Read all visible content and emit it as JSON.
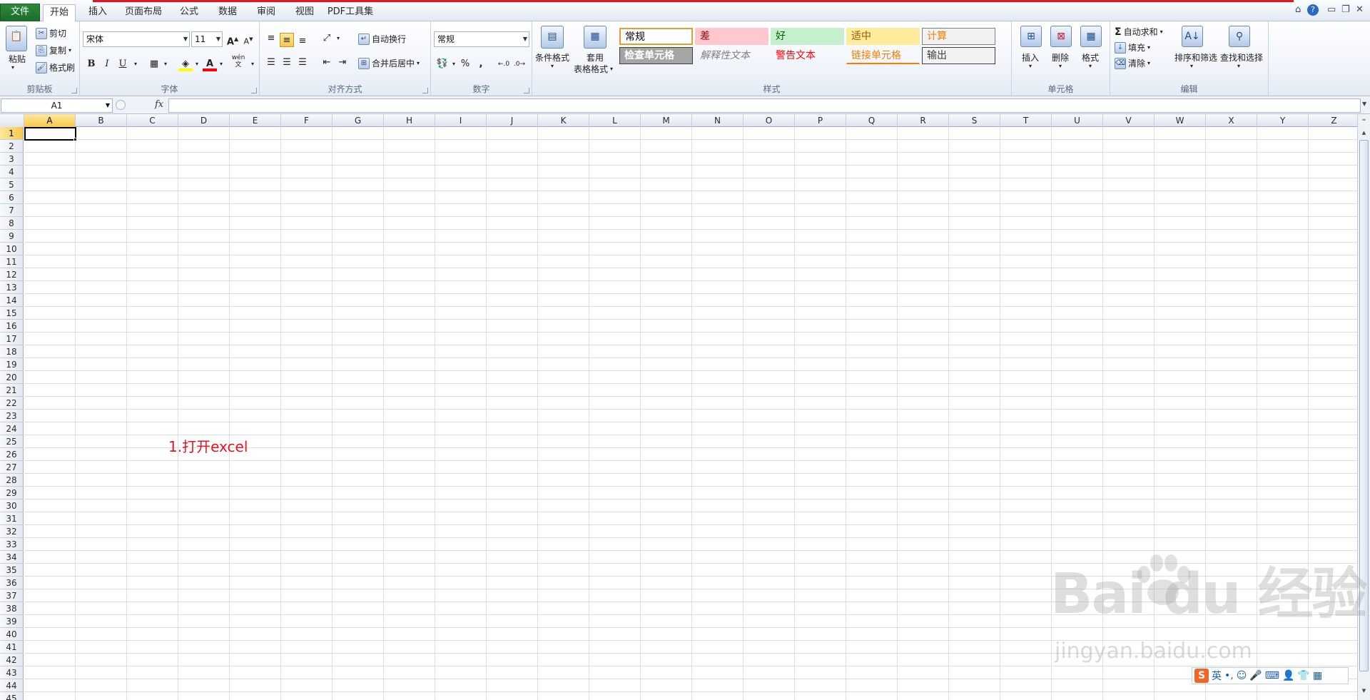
{
  "tabs": [
    {
      "label": "文件",
      "key": "file"
    },
    {
      "label": "开始",
      "key": "home"
    },
    {
      "label": "插入",
      "key": "insert"
    },
    {
      "label": "页面布局",
      "key": "layout"
    },
    {
      "label": "公式",
      "key": "formulas"
    },
    {
      "label": "数据",
      "key": "data"
    },
    {
      "label": "审阅",
      "key": "review"
    },
    {
      "label": "视图",
      "key": "view"
    },
    {
      "label": "PDF工具集",
      "key": "pdf"
    }
  ],
  "active_tab": "开始",
  "clipboard": {
    "paste": "粘贴",
    "cut": "剪切",
    "copy": "复制",
    "format_painter": "格式刷",
    "group": "剪贴板"
  },
  "font": {
    "name": "宋体",
    "size": "11",
    "bold": "B",
    "italic": "I",
    "underline": "U",
    "phonetic": "wén",
    "group": "字体"
  },
  "alignment": {
    "wrap": "自动换行",
    "merge": "合并后居中",
    "group": "对齐方式"
  },
  "number": {
    "format": "常规",
    "percent": "%",
    "comma": ",",
    "group": "数字"
  },
  "styles": {
    "conditional": "条件格式",
    "table_l1": "套用",
    "table_l2": "表格格式",
    "cells": [
      {
        "label": "常规",
        "color": "#000000",
        "bg": "#ffffff",
        "border": "#e0a030"
      },
      {
        "label": "差",
        "color": "#9c0006",
        "bg": "#ffc7ce",
        "border": ""
      },
      {
        "label": "好",
        "color": "#006100",
        "bg": "#c6efce",
        "border": ""
      },
      {
        "label": "适中",
        "color": "#9c5700",
        "bg": "#ffeb9c",
        "border": ""
      },
      {
        "label": "计算",
        "color": "#fa7d00",
        "bg": "#f2f2f2",
        "border": "#7f7f7f"
      },
      {
        "label": "检查单元格",
        "color": "#ffffff",
        "bg": "#a5a5a5",
        "border": "#3f3f3f"
      },
      {
        "label": "解释性文本",
        "color": "#7f7f7f",
        "bg": "",
        "border": ""
      },
      {
        "label": "警告文本",
        "color": "#ff0000",
        "bg": "",
        "border": ""
      },
      {
        "label": "链接单元格",
        "color": "#fa7d00",
        "bg": "",
        "border": ""
      },
      {
        "label": "输出",
        "color": "#3f3f3f",
        "bg": "#f2f2f2",
        "border": "#3f3f3f"
      }
    ],
    "group": "样式"
  },
  "cells_group": {
    "insert": "插入",
    "delete": "删除",
    "format": "格式",
    "group": "单元格"
  },
  "editing": {
    "autosum": "自动求和",
    "fill": "填充",
    "clear": "清除",
    "sort": "排序和筛选",
    "find": "查找和选择",
    "group": "编辑"
  },
  "formula_bar": {
    "name_box": "A1",
    "fx": "fx",
    "formula": ""
  },
  "columns": [
    "A",
    "B",
    "C",
    "D",
    "E",
    "F",
    "G",
    "H",
    "I",
    "J",
    "K",
    "L",
    "M",
    "N",
    "O",
    "P",
    "Q",
    "R",
    "S",
    "T",
    "U",
    "V",
    "W",
    "X",
    "Y",
    "Z"
  ],
  "selected_column": "A",
  "selected_row": 1,
  "row_count": 45,
  "annotation": "1.打开excel",
  "watermark": {
    "brand": "Bai du 经验",
    "url": "jingyan.baidu.com"
  },
  "ime": {
    "logo": "S",
    "lang": "英"
  }
}
